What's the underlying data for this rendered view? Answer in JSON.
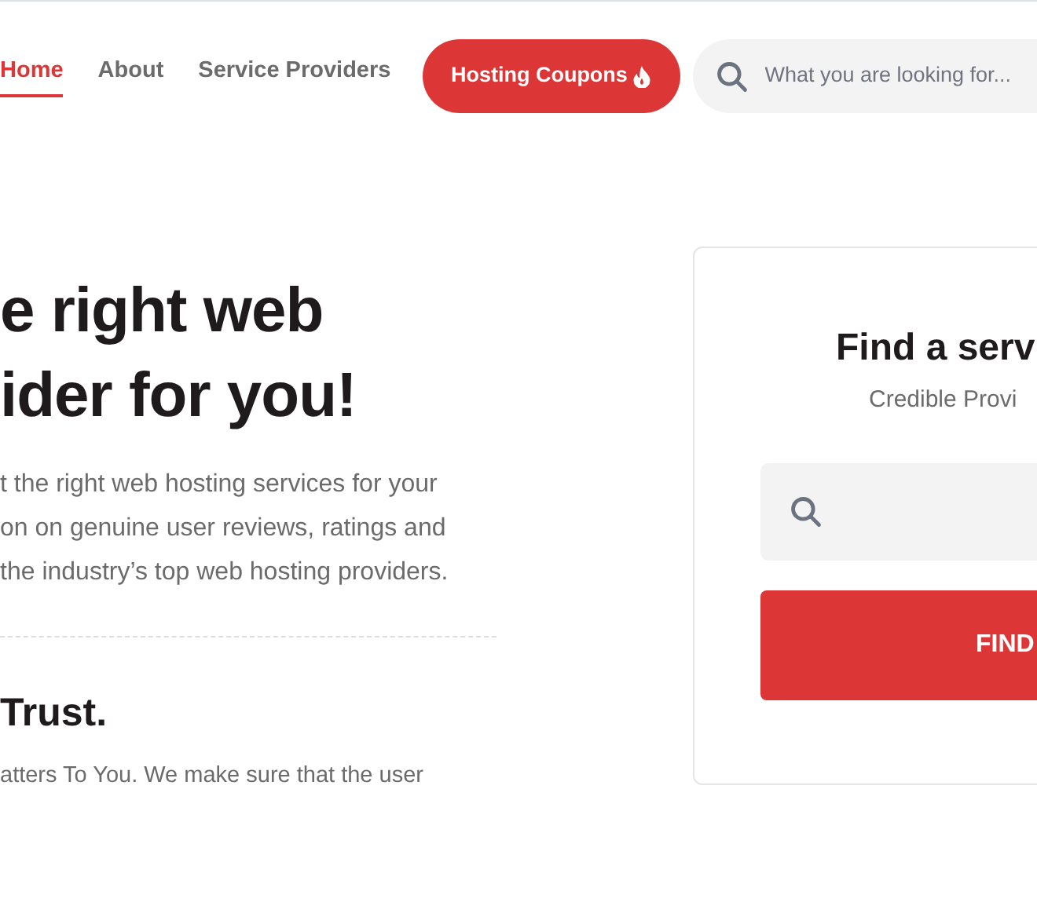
{
  "nav": {
    "links": [
      {
        "label": "Home",
        "selected": true
      },
      {
        "label": "About",
        "selected": false
      },
      {
        "label": "Service Providers",
        "selected": false
      }
    ],
    "coupon_button": "Hosting Coupons",
    "search": {
      "placeholder": "What you are looking for..."
    }
  },
  "hero": {
    "heading": [
      "e right web",
      "ider for you!"
    ],
    "paragraph": [
      "t the right web hosting services for your",
      "on on genuine user reviews, ratings and",
      "the industry’s top web hosting providers."
    ],
    "trust_heading": "Trust.",
    "trust_text": "atters To You. We make sure that the user"
  },
  "finder": {
    "title": "Find a serv",
    "subtitle": "Credible Provi",
    "button": "FIND"
  }
}
